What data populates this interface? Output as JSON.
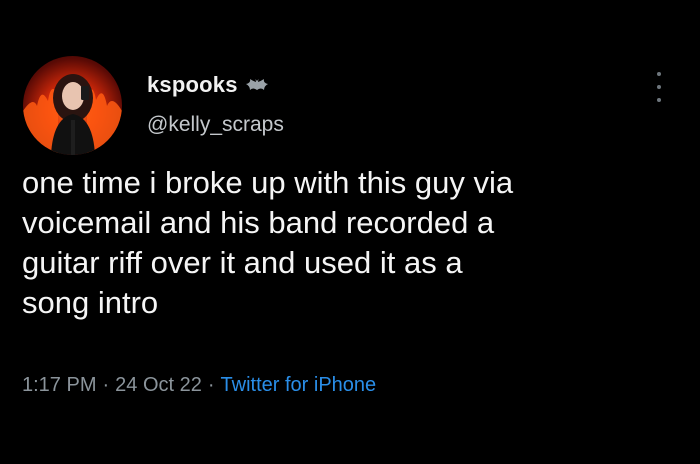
{
  "user": {
    "display_name": "kspooks",
    "handle": "@kelly_scraps",
    "badge_icon": "bat-icon",
    "avatar_icon": "avatar"
  },
  "tweet": {
    "text": "one time i broke up with this guy via\nvoicemail and his band recorded a\nguitar riff over it and used it as a\nsong intro"
  },
  "meta": {
    "time": "1:17 PM",
    "separator": "·",
    "date": "24 Oct 22",
    "source": "Twitter for iPhone"
  },
  "colors": {
    "background": "#000000",
    "text": "#f5f5f5",
    "secondary_text": "#8b949b",
    "link": "#2a8ee8"
  },
  "menu": {
    "icon": "more-vertical-icon"
  }
}
